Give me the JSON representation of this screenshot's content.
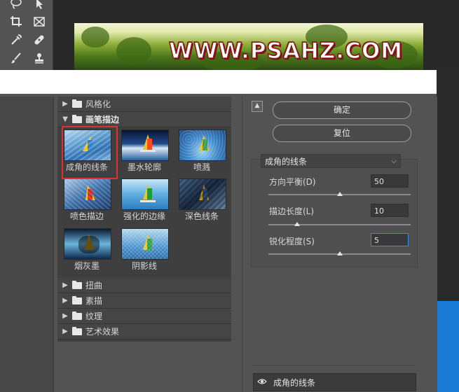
{
  "canvas": {
    "watermark": "WWW.PSAHZ.COM"
  },
  "toolbar": {
    "tools": [
      "lasso-icon",
      "magic-wand-icon",
      "crop-icon",
      "frame-icon",
      "eyedropper-icon",
      "healing-icon",
      "brush-icon",
      "stamp-icon"
    ]
  },
  "gallery": {
    "categories_top": [
      {
        "label": "风格化",
        "open": false
      },
      {
        "label": "画笔描边",
        "open": true
      }
    ],
    "thumbnails": [
      {
        "label": "成角的线条",
        "selected": true
      },
      {
        "label": "墨水轮廓",
        "selected": false
      },
      {
        "label": "喷溅",
        "selected": false
      },
      {
        "label": "喷色描边",
        "selected": false
      },
      {
        "label": "强化的边缘",
        "selected": false
      },
      {
        "label": "深色线条",
        "selected": false
      },
      {
        "label": "烟灰墨",
        "selected": false
      },
      {
        "label": "阴影线",
        "selected": false
      }
    ],
    "categories_bottom": [
      {
        "label": "扭曲",
        "open": false
      },
      {
        "label": "素描",
        "open": false
      },
      {
        "label": "纹理",
        "open": false
      },
      {
        "label": "艺术效果",
        "open": false
      }
    ]
  },
  "panel": {
    "ok_label": "确定",
    "reset_label": "复位",
    "filter_select": "成角的线条",
    "params": [
      {
        "label": "方向平衡(D)",
        "value": "50",
        "level": 50,
        "max": 100
      },
      {
        "label": "描边长度(L)",
        "value": "10",
        "level": 10,
        "max": 50
      },
      {
        "label": "锐化程度(S)",
        "value": "5",
        "level": 5,
        "max": 10
      }
    ],
    "layer_name": "成角的线条"
  },
  "colors": {
    "selection_border": "#e03030",
    "focus_border": "#3a8ee6",
    "dialog_bg": "#535353"
  }
}
